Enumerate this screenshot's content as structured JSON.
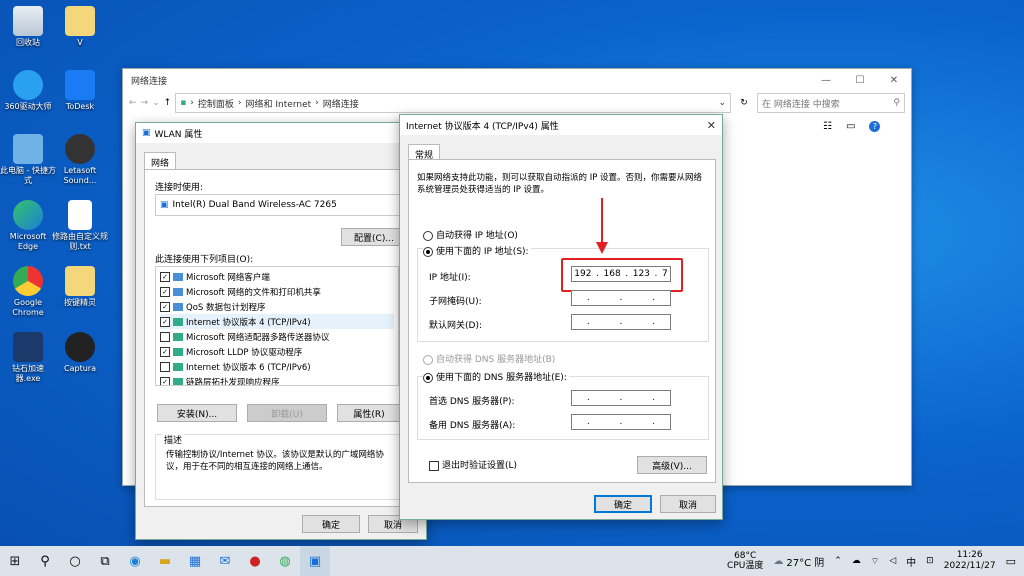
{
  "desktop": {
    "icons": [
      {
        "label": "回收站"
      },
      {
        "label": "V"
      },
      {
        "label": "360驱动大师"
      },
      {
        "label": "ToDesk"
      },
      {
        "label": "此电脑 - 快捷方式"
      },
      {
        "label": "Letasoft Sound..."
      },
      {
        "label": "Microsoft Edge"
      },
      {
        "label": "修路由自定义规则.txt"
      },
      {
        "label": "Google Chrome"
      },
      {
        "label": "按键精灵"
      },
      {
        "label": "钻石加速器.exe"
      },
      {
        "label": "Captura"
      }
    ]
  },
  "explorer": {
    "title": "网络连接",
    "breadcrumb": [
      "控制面板",
      "网络和 Internet",
      "网络连接"
    ],
    "search_placeholder": "在 网络连接 中搜索",
    "refresh": "↻"
  },
  "wlan": {
    "title": "WLAN 属性",
    "tab": "网络",
    "connect_using_label": "连接时使用:",
    "adapter": "Intel(R) Dual Band Wireless-AC 7265",
    "configure_button": "配置(C)...",
    "items_label": "此连接使用下列项目(O):",
    "items": [
      {
        "label": "Microsoft 网络客户端",
        "checked": true
      },
      {
        "label": "Microsoft 网络的文件和打印机共享",
        "checked": true
      },
      {
        "label": "QoS 数据包计划程序",
        "checked": true
      },
      {
        "label": "Internet 协议版本 4 (TCP/IPv4)",
        "checked": true
      },
      {
        "label": "Microsoft 网络适配器多路传送器协议",
        "checked": false
      },
      {
        "label": "Microsoft LLDP 协议驱动程序",
        "checked": true
      },
      {
        "label": "Internet 协议版本 6 (TCP/IPv6)",
        "checked": false
      },
      {
        "label": "链路层拓扑发现响应程序",
        "checked": true
      }
    ],
    "install_button": "安装(N)...",
    "uninstall_button": "卸载(U)",
    "properties_button": "属性(R)",
    "description_label": "描述",
    "description_text": "传输控制协议/Internet 协议。该协议是默认的广域网络协议，用于在不同的相互连接的网络上通信。",
    "ok_button": "确定",
    "cancel_button": "取消"
  },
  "ipv4": {
    "title": "Internet 协议版本 4 (TCP/IPv4) 属性",
    "tab": "常规",
    "intro": "如果网络支持此功能，则可以获取自动指派的 IP 设置。否则，你需要从网络系统管理员处获得适当的 IP 设置。",
    "auto_ip": "自动获得 IP 地址(O)",
    "manual_ip": "使用下面的 IP 地址(S):",
    "ip_label": "IP 地址(I):",
    "ip_value": [
      "192",
      "168",
      "123",
      "7"
    ],
    "mask_label": "子网掩码(U):",
    "gateway_label": "默认网关(D):",
    "auto_dns": "自动获得 DNS 服务器地址(B)",
    "manual_dns": "使用下面的 DNS 服务器地址(E):",
    "dns1_label": "首选 DNS 服务器(P):",
    "dns2_label": "备用 DNS 服务器(A):",
    "validate_label": "退出时验证设置(L)",
    "advanced_button": "高级(V)...",
    "ok_button": "确定",
    "cancel_button": "取消",
    "highlight_color": "#e02020"
  },
  "taskbar": {
    "temp": "68°C",
    "temp_label": "CPU温度",
    "weather": "27°C 阴",
    "ime": "中",
    "time": "11:26",
    "date": "2022/11/27"
  }
}
